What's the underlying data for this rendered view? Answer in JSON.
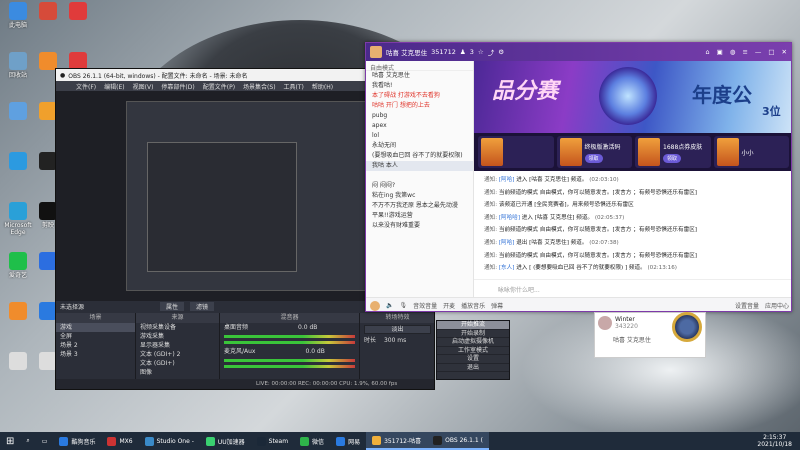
{
  "desktop": {
    "icons": [
      {
        "label": "此电脑",
        "color": "#3b8be0"
      },
      {
        "label": "",
        "color": "#d64b3a"
      },
      {
        "label": "",
        "color": "#e03b3b"
      },
      {
        "label": "回收站",
        "color": "#6fa0c8"
      },
      {
        "label": "",
        "color": "#f08c2c"
      },
      {
        "label": "",
        "color": "#e03b3b"
      },
      {
        "label": "",
        "color": "#5fa0e0"
      },
      {
        "label": "",
        "color": "#f0a02c"
      },
      {
        "label": "GeForce Experience",
        "color": "#76b900"
      },
      {
        "label": "",
        "color": "#2c9ae0"
      },
      {
        "label": "",
        "color": "#222222"
      },
      {
        "label": "",
        "color": "#2a7ae0"
      },
      {
        "label": "Microsoft Edge",
        "color": "#2aa0d8"
      },
      {
        "label": "剪映",
        "color": "#111111"
      },
      {
        "label": "",
        "color": "#2fae4a"
      },
      {
        "label": "爱奇艺",
        "color": "#1fbf4a"
      },
      {
        "label": "",
        "color": "#2c6ee0"
      },
      {
        "label": "",
        "color": "#e04a8c"
      },
      {
        "label": "",
        "color": "#f08c2c"
      },
      {
        "label": "",
        "color": "#2a7ae0"
      },
      {
        "label": "",
        "color": "#f0b02c"
      },
      {
        "label": "",
        "color": "#dddddd"
      },
      {
        "label": "",
        "color": "#dddddd"
      },
      {
        "label": "",
        "color": "#dddddd"
      }
    ]
  },
  "obs": {
    "title": "OBS 26.1.1 (64-bit, windows) - 配置文件: 未命名 - 场景: 未命名",
    "menu": [
      "文件(F)",
      "编辑(E)",
      "视图(V)",
      "停靠部件(D)",
      "配置文件(P)",
      "场景集合(S)",
      "工具(T)",
      "帮助(H)"
    ],
    "no_source": "未选择源",
    "properties_label": "属性",
    "filters_label": "滤镜",
    "scenes_header": "场景",
    "scenes": [
      "游戏",
      "全屏",
      "场景 2",
      "场景 3"
    ],
    "sources_header": "来源",
    "sources": [
      "视频采集设备",
      "游戏采集",
      "显示器采集",
      "文本 (GDI+) 2",
      "文本 (GDI+)",
      "图像"
    ],
    "mixer_header": "混音器",
    "mixer": [
      {
        "name": "桌面音频",
        "level": "0.0 dB"
      },
      {
        "name": "麦克风/Aux",
        "level": "0.0 dB"
      }
    ],
    "transitions_header": "转场特效",
    "transition_selected": "淡出",
    "duration_label": "时长",
    "duration_value": "300 ms",
    "controls_header": "控件",
    "controls": [
      "开始推流",
      "开始录制",
      "启动虚拟摄像机",
      "工作室模式",
      "设置",
      "退出"
    ],
    "status": "LIVE: 00:00:00   REC: 00:00:00   CPU: 1.9%, 60.00 fps"
  },
  "yy": {
    "channel_name": "咕喜 艾克思住",
    "channel_id": "351712",
    "online": "3",
    "left_sub": "自由模式",
    "channels": [
      {
        "label": "咕喜 艾克思住",
        "style": ""
      },
      {
        "label": "我看咕!",
        "style": ""
      },
      {
        "label": "本了碍战 打游戏不去看狗",
        "style": "red"
      },
      {
        "label": "咕咕 开门 想把的上去",
        "style": "red"
      },
      {
        "label": "pubg",
        "style": ""
      },
      {
        "label": "apex",
        "style": ""
      },
      {
        "label": "lol",
        "style": ""
      },
      {
        "label": "永劫无间",
        "style": ""
      },
      {
        "label": "(要想吸血已回 谷不了的就要权限)",
        "style": ""
      },
      {
        "label": "我咕 本人",
        "style": "sel"
      },
      {
        "label": "",
        "style": ""
      },
      {
        "label": "闷 闷闷?",
        "style": ""
      },
      {
        "label": "粘在ing 我第wc",
        "style": ""
      },
      {
        "label": "不万不万我还原 恩本之最先动漫",
        "style": ""
      },
      {
        "label": "平果!!游戏运营",
        "style": ""
      },
      {
        "label": "以来没有财难重要",
        "style": ""
      }
    ],
    "cards": [
      {
        "title": "",
        "action": ""
      },
      {
        "title": "终极版激活码",
        "action": "领取"
      },
      {
        "title": "1688点券皮肤",
        "action": "领取"
      },
      {
        "title": "小小",
        "action": ""
      }
    ],
    "messages": [
      {
        "prefix": "通知:",
        "name": "[阿哈]",
        "text": "进入 [咕喜 艾克思住] 频道。",
        "time": "(02:03:10)"
      },
      {
        "prefix": "通知:",
        "name": "",
        "text": "当前频道的模式 自由模式，你可以随意发言。[发言方 ；有频号恐惧还乐有雷区]",
        "time": ""
      },
      {
        "prefix": "通知:",
        "name": "",
        "text": "该频道已开通 [全民竞赛者]，用来频号恐惧还乐有雷区",
        "time": ""
      },
      {
        "prefix": "通知:",
        "name": "[阿哈哈]",
        "text": "进入 [咕喜 艾克思住] 频道。",
        "time": "(02:05:37)"
      },
      {
        "prefix": "通知:",
        "name": "",
        "text": "当前频道的模式 自由模式，你可以随意发言。[发言方 ；有频号恐惧还乐有雷区]",
        "time": ""
      },
      {
        "prefix": "通知:",
        "name": "[阿哈]",
        "text": "退出 [咕喜 艾克思住] 频道。",
        "time": "(02:07:38)"
      },
      {
        "prefix": "通知:",
        "name": "",
        "text": "当前频道的模式 自由模式，你可以随意发言。[发言方 ；有频号恐惧还乐有雷区]",
        "time": ""
      },
      {
        "prefix": "通知:",
        "name": "[东人]",
        "text": "进入 [ (要想要吸血已回 谷不了的就要权限) ] 频道。",
        "time": "(02:13:16)"
      }
    ],
    "input_placeholder": "咏咏你什么吧...",
    "bottom_items": [
      "音效音量",
      "开麦",
      "播放音乐",
      "弹幕"
    ],
    "bottom_right": [
      "设置音量",
      "应用中心"
    ]
  },
  "mini_card": {
    "name": "Winter",
    "id": "343220",
    "label": "咕喜 艾克思住"
  },
  "taskbar": {
    "items": [
      {
        "label": "酷狗音乐",
        "color": "#2a7ae0",
        "active": false
      },
      {
        "label": "MX6",
        "color": "#cc3333",
        "active": false
      },
      {
        "label": "Studio One -",
        "color": "#3a8ac8",
        "active": false
      },
      {
        "label": "UU加速器",
        "color": "#3ad070",
        "active": false
      },
      {
        "label": "Steam",
        "color": "#1b2838",
        "active": false
      },
      {
        "label": "微信",
        "color": "#2fb34a",
        "active": false
      },
      {
        "label": "网易",
        "color": "#2a7ae0",
        "active": false
      },
      {
        "label": "351712-咕喜",
        "color": "#f0b03c",
        "active": true
      },
      {
        "label": "OBS 26.1.1 (",
        "color": "#222222",
        "active": true
      }
    ],
    "time": "2:15:37",
    "date": "2021/10/18"
  }
}
